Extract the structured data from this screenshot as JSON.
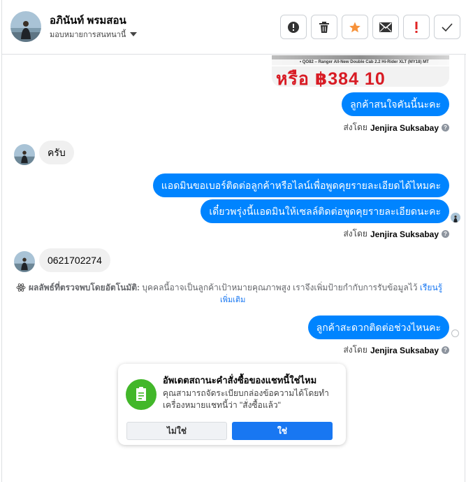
{
  "header": {
    "contact_name": "อภินันท์ พรมสอน",
    "assign_label": "มอบหมายการสนทนานี้",
    "toolbar": [
      {
        "icon": "alert-circle-icon"
      },
      {
        "icon": "trash-icon"
      },
      {
        "icon": "star-icon",
        "color": "#f7923a"
      },
      {
        "icon": "envelope-icon"
      },
      {
        "icon": "exclamation-icon",
        "color": "#e02424"
      },
      {
        "icon": "checkmark-icon"
      }
    ]
  },
  "image_preview": {
    "caption": "• QO82 – Ranger All-New Double Cab 2.2 Hi-Rider XLT (MY18) MT",
    "promo": "หรือ ฿384 10"
  },
  "messages": [
    {
      "direction": "out",
      "text": "ลูกค้าสนใจคันนี้นะคะ"
    },
    {
      "direction": "in",
      "text": "ครับ"
    },
    {
      "direction": "out",
      "text": "แอดมินขอเบอร์ติดต่อลูกค้าหรือไลน์เพื่อพูดคุยรายละเอียดได้ไหมคะ"
    },
    {
      "direction": "out",
      "text": "เดี๋ยวพรุ่งนี้แอดมินให้เซลล์ติดต่อพูดคุยรายละเอียดนะคะ"
    },
    {
      "direction": "in",
      "text": "0621702274"
    },
    {
      "direction": "out",
      "text": "ลูกค้าสะดวกติดต่อช่วงไหนคะ"
    }
  ],
  "sent_by": {
    "prefix": "ส่งโดย",
    "agent": "Jenjira Suksabay"
  },
  "ai_note": {
    "label": "ผลลัพธ์ที่ตรวจพบโดยอัตโนมัติ:",
    "text": "บุคคลนี้อาจเป็นลูกค้าเป้าหมายคุณภาพสูง เราจึงเพิ่มป้ายกำกับการรับข้อมูลไว้",
    "learn_more_1": "เรียนรู้",
    "learn_more_2": "เพิ่มเติม"
  },
  "status_card": {
    "title": "อัพเดตสถานะคำสั่งซื้อของแชทนี้ใช่ไหม",
    "body": "คุณสามารถจัดระเบียบกล่องข้อความได้โดยทำเครื่องหมายแชทนี้ว่า \"สั่งซื้อแล้ว\"",
    "no_label": "ไม่ใช่",
    "yes_label": "ใช่"
  },
  "colors": {
    "outgoing_bubble": "#0084ff",
    "incoming_bubble": "#f0f0f0",
    "primary_button": "#1877f2",
    "card_icon_bg": "#42b72a"
  }
}
